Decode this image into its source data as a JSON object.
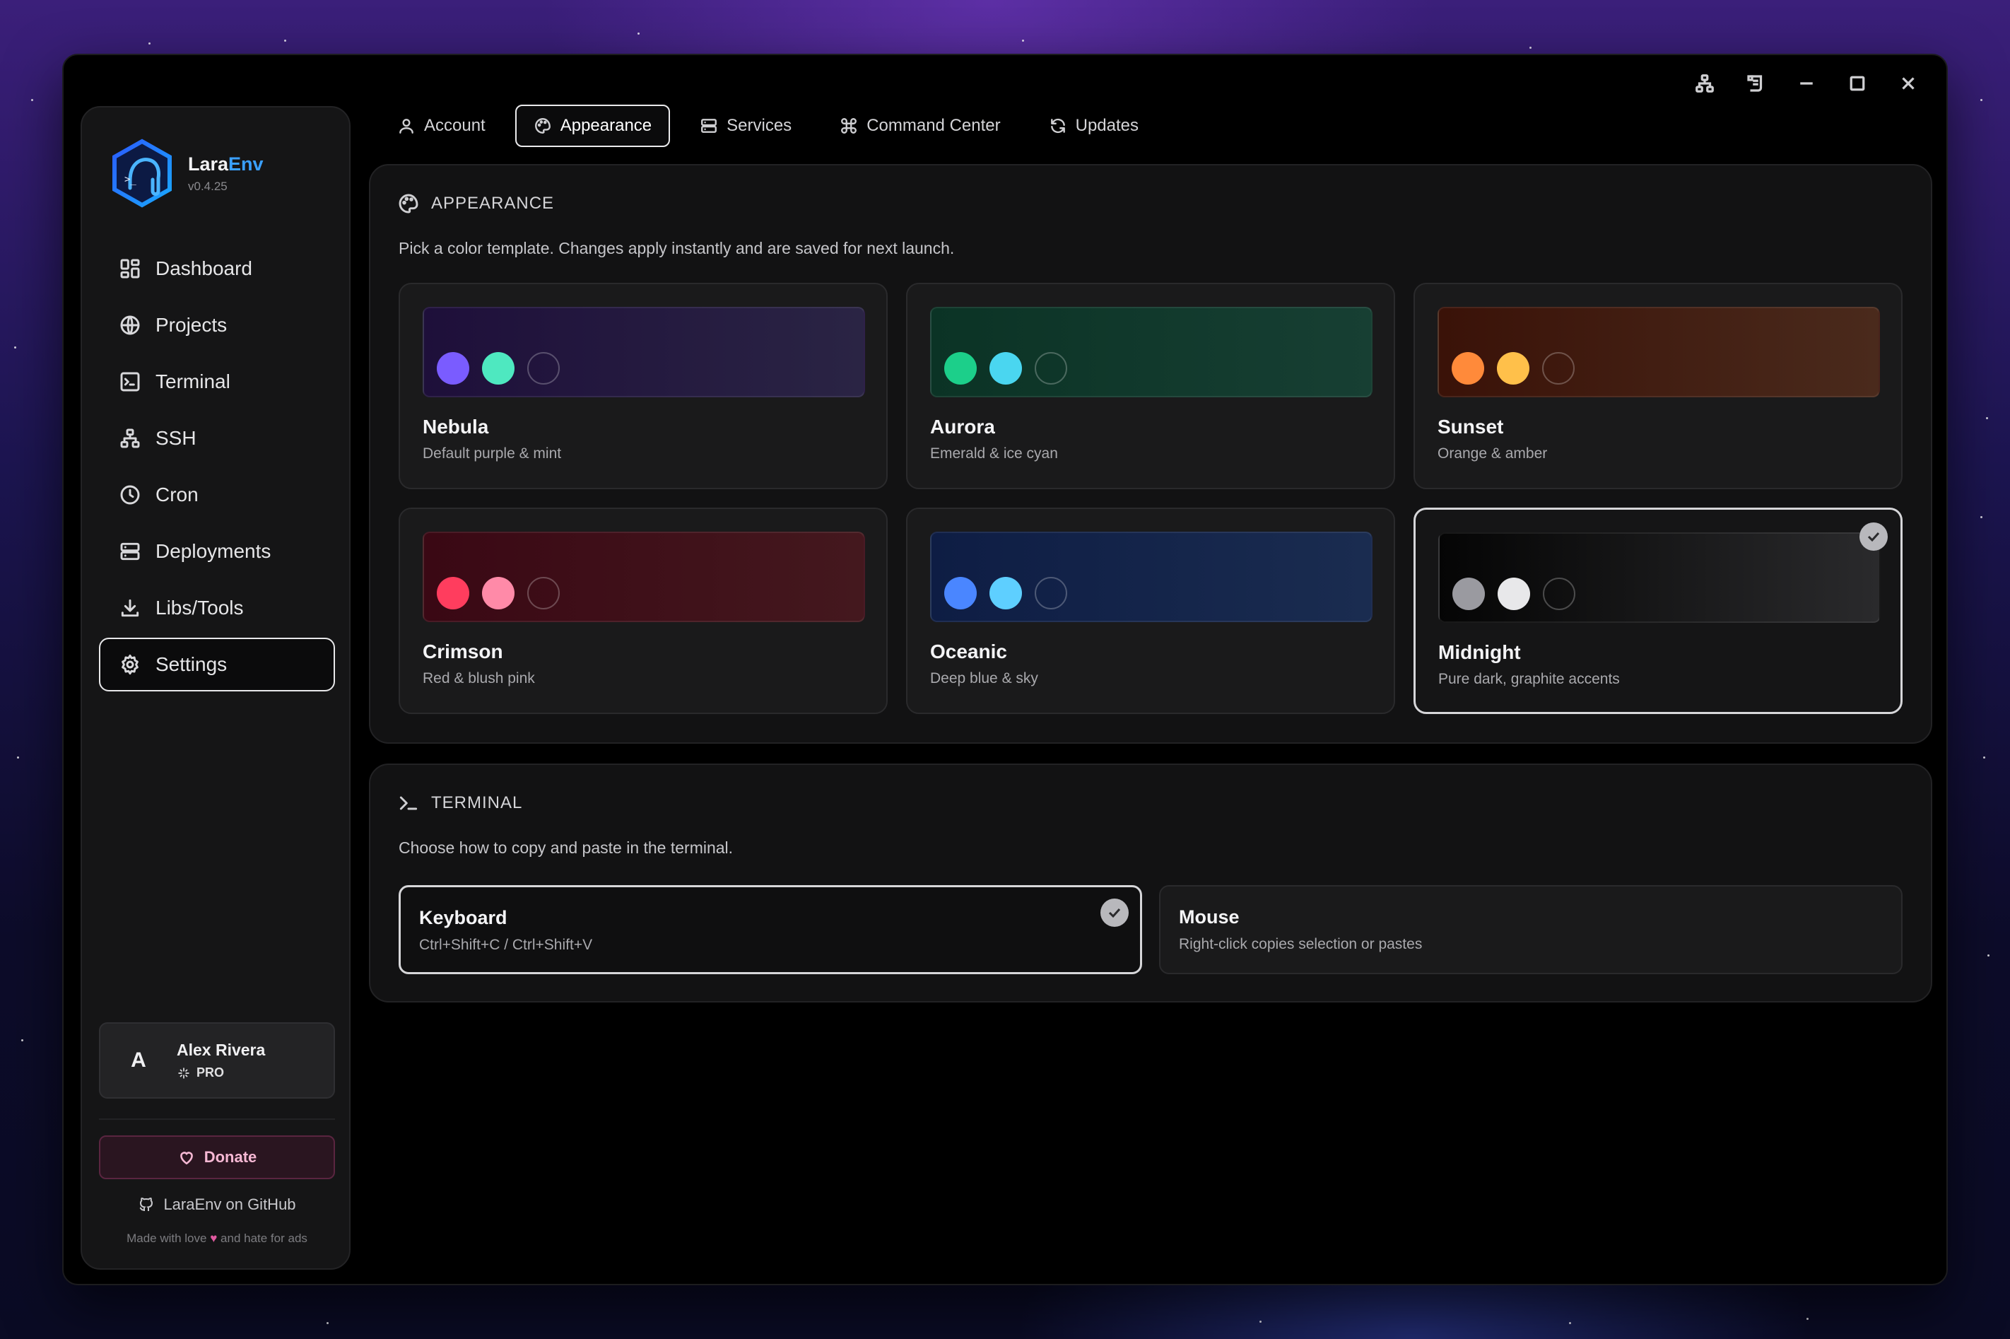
{
  "app": {
    "name_main": "Lara",
    "name_accent": "Env",
    "version": "v0.4.25"
  },
  "sidebar": {
    "items": [
      {
        "label": "Dashboard",
        "icon": "dashboard-icon"
      },
      {
        "label": "Projects",
        "icon": "globe-icon"
      },
      {
        "label": "Terminal",
        "icon": "terminal-icon"
      },
      {
        "label": "SSH",
        "icon": "network-icon"
      },
      {
        "label": "Cron",
        "icon": "clock-icon"
      },
      {
        "label": "Deployments",
        "icon": "server-icon"
      },
      {
        "label": "Libs/Tools",
        "icon": "download-icon"
      },
      {
        "label": "Settings",
        "icon": "gear-icon",
        "active": true
      }
    ],
    "user": {
      "initial": "A",
      "name": "Alex Rivera",
      "tier": "PRO"
    },
    "donate_label": "Donate",
    "github_label": "LaraEnv on GitHub",
    "footer_pre": "Made with love",
    "footer_post": "and hate for ads"
  },
  "tabs": [
    {
      "label": "Account",
      "icon": "user-icon"
    },
    {
      "label": "Appearance",
      "icon": "palette-icon",
      "active": true
    },
    {
      "label": "Services",
      "icon": "server-icon"
    },
    {
      "label": "Command Center",
      "icon": "command-icon"
    },
    {
      "label": "Updates",
      "icon": "refresh-icon"
    }
  ],
  "appearance": {
    "heading": "APPEARANCE",
    "description": "Pick a color template. Changes apply instantly and are saved for next launch.",
    "themes": [
      {
        "name": "Nebula",
        "subtitle": "Default purple & mint",
        "colors": [
          "#7a5cff",
          "#4ee8c0"
        ],
        "bg_from": "#1e0f3a",
        "bg_to": "#2a2444"
      },
      {
        "name": "Aurora",
        "subtitle": "Emerald & ice cyan",
        "colors": [
          "#1ccf8a",
          "#4ad6f0"
        ],
        "bg_from": "#0b3325",
        "bg_to": "#173f33"
      },
      {
        "name": "Sunset",
        "subtitle": "Orange & amber",
        "colors": [
          "#ff8a3a",
          "#ffc04a"
        ],
        "bg_from": "#3a1208",
        "bg_to": "#4a2a1c"
      },
      {
        "name": "Crimson",
        "subtitle": "Red & blush pink",
        "colors": [
          "#ff3d5e",
          "#ff8aa8"
        ],
        "bg_from": "#3a0814",
        "bg_to": "#44181e"
      },
      {
        "name": "Oceanic",
        "subtitle": "Deep blue & sky",
        "colors": [
          "#4a86ff",
          "#5ecfff"
        ],
        "bg_from": "#0e1d44",
        "bg_to": "#1a2c50"
      },
      {
        "name": "Midnight",
        "subtitle": "Pure dark, graphite accents",
        "colors": [
          "#9a9aa0",
          "#e8e8ea"
        ],
        "bg_from": "#050505",
        "bg_to": "#2a2a2c",
        "selected": true
      }
    ]
  },
  "terminal": {
    "heading": "TERMINAL",
    "description": "Choose how to copy and paste in the terminal.",
    "options": [
      {
        "name": "Keyboard",
        "subtitle": "Ctrl+Shift+C / Ctrl+Shift+V",
        "selected": true
      },
      {
        "name": "Mouse",
        "subtitle": "Right-click copies selection or pastes"
      }
    ]
  }
}
